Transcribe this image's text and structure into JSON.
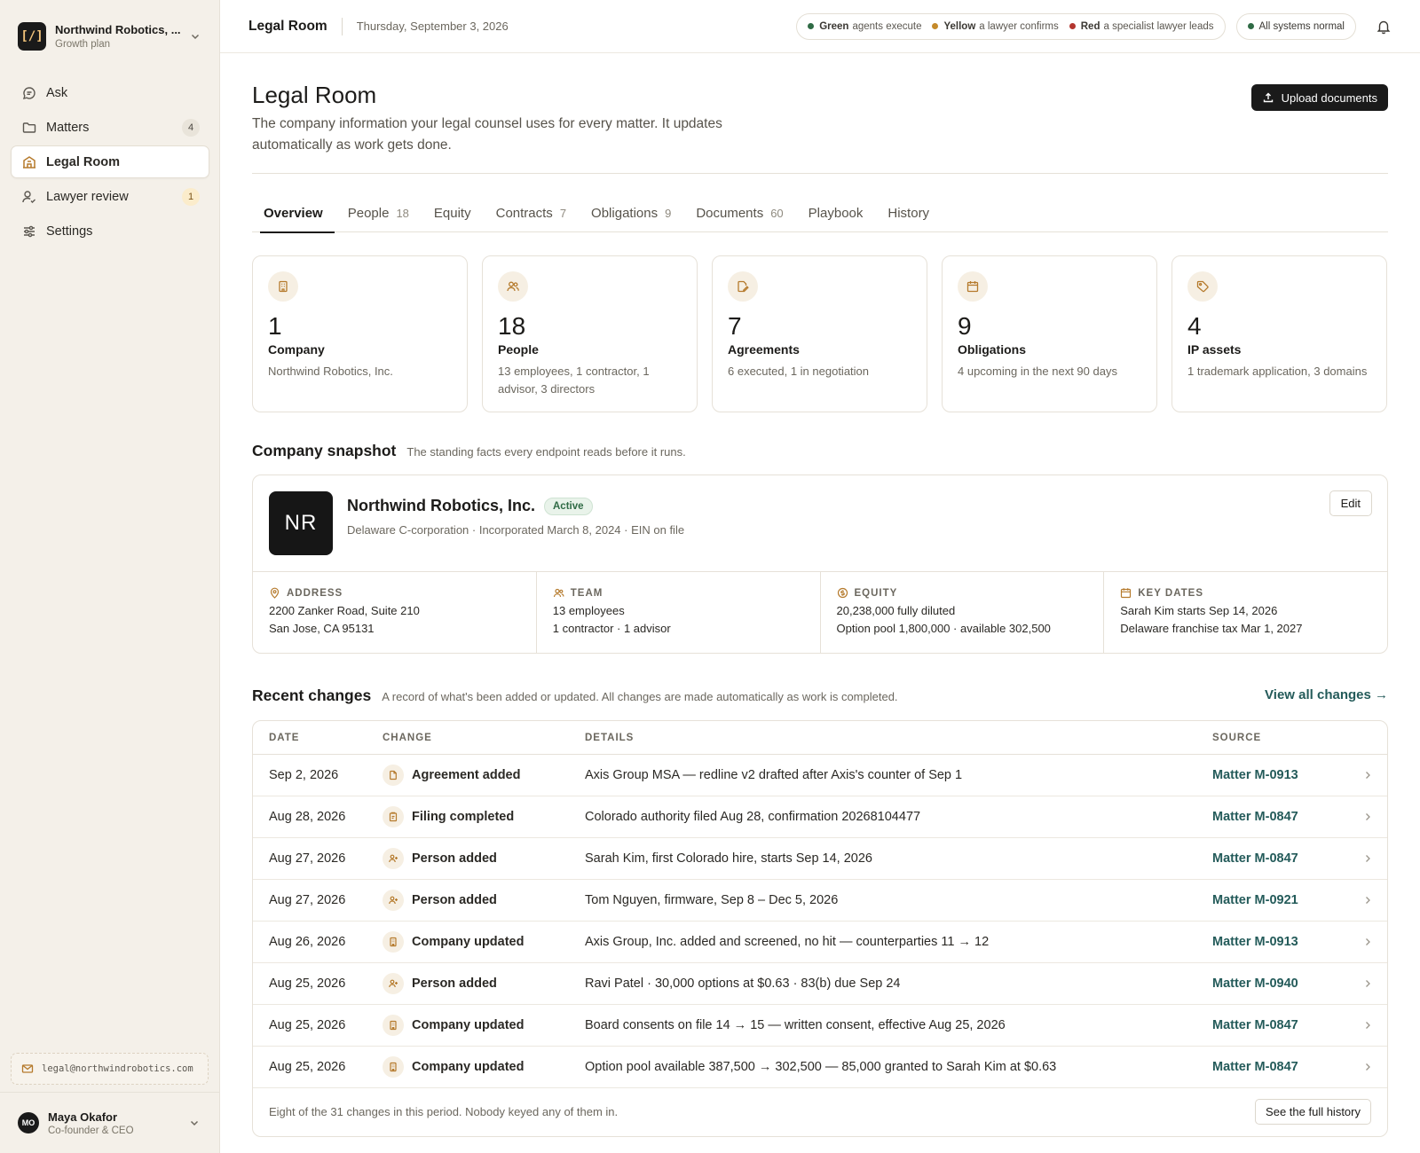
{
  "org": {
    "name": "Northwind Robotics, ...",
    "plan": "Growth plan",
    "logo_text": "[/]"
  },
  "nav": [
    {
      "label": "Ask",
      "icon": "chat-icon",
      "badge": ""
    },
    {
      "label": "Matters",
      "icon": "folder-icon",
      "badge": "4"
    },
    {
      "label": "Legal Room",
      "icon": "building-icon",
      "badge": "",
      "active": true
    },
    {
      "label": "Lawyer review",
      "icon": "user-review-icon",
      "badge": "1"
    },
    {
      "label": "Settings",
      "icon": "sliders-icon",
      "badge": ""
    }
  ],
  "sidebar_email": "legal@northwindrobotics.com",
  "user": {
    "initials": "MO",
    "name": "Maya Okafor",
    "role": "Co-founder & CEO"
  },
  "topbar": {
    "title": "Legal Room",
    "date": "Thursday, September 3, 2026",
    "legend": [
      {
        "strong": "Green",
        "text": "agents execute",
        "color": "#2f6b45"
      },
      {
        "strong": "Yellow",
        "text": "a lawyer confirms",
        "color": "#c58a2a"
      },
      {
        "strong": "Red",
        "text": "a specialist lawyer leads",
        "color": "#b3362f"
      }
    ],
    "status": "All systems normal",
    "status_color": "#2f6b45"
  },
  "page": {
    "title": "Legal Room",
    "subtitle": "The company information your legal counsel uses for every matter. It updates automatically as work gets done.",
    "upload_label": "Upload documents"
  },
  "tabs": [
    {
      "label": "Overview",
      "count": "",
      "active": true
    },
    {
      "label": "People",
      "count": "18"
    },
    {
      "label": "Equity",
      "count": ""
    },
    {
      "label": "Contracts",
      "count": "7"
    },
    {
      "label": "Obligations",
      "count": "9"
    },
    {
      "label": "Documents",
      "count": "60"
    },
    {
      "label": "Playbook",
      "count": ""
    },
    {
      "label": "History",
      "count": ""
    }
  ],
  "stats": [
    {
      "icon": "building-icon",
      "num": "1",
      "label": "Company",
      "desc": "Northwind Robotics, Inc."
    },
    {
      "icon": "people-icon",
      "num": "18",
      "label": "People",
      "desc": "13 employees, 1 contractor, 1 advisor, 3 directors"
    },
    {
      "icon": "edit-doc-icon",
      "num": "7",
      "label": "Agreements",
      "desc": "6 executed, 1 in negotiation"
    },
    {
      "icon": "calendar-icon",
      "num": "9",
      "label": "Obligations",
      "desc": "4 upcoming in the next 90 days"
    },
    {
      "icon": "tag-icon",
      "num": "4",
      "label": "IP assets",
      "desc": "1 trademark application, 3 domains"
    }
  ],
  "snapshot": {
    "title": "Company snapshot",
    "subtitle": "The standing facts every endpoint reads before it runs.",
    "logo": "NR",
    "name": "Northwind Robotics, Inc.",
    "badge": "Active",
    "meta": "Delaware C-corporation · Incorporated March 8, 2024 · EIN on file",
    "edit_label": "Edit",
    "cells": [
      {
        "head": "ADDRESS",
        "icon": "pin-icon",
        "line1": "2200 Zanker Road, Suite 210",
        "line2": "San Jose, CA 95131"
      },
      {
        "head": "TEAM",
        "icon": "people-icon",
        "line1": "13 employees",
        "line2": "1 contractor · 1 advisor"
      },
      {
        "head": "EQUITY",
        "icon": "coin-icon",
        "line1": "20,238,000 fully diluted",
        "line2": "Option pool 1,800,000 · available 302,500"
      },
      {
        "head": "KEY DATES",
        "icon": "calendar-icon",
        "line1": "Sarah Kim starts Sep 14, 2026",
        "line2": "Delaware franchise tax Mar 1, 2027"
      }
    ]
  },
  "changes": {
    "title": "Recent changes",
    "subtitle": "A record of what's been added or updated. All changes are made automatically as work is completed.",
    "view_all": "View all changes →",
    "columns": [
      "DATE",
      "CHANGE",
      "DETAILS",
      "SOURCE"
    ],
    "rows": [
      {
        "date": "Sep 2, 2026",
        "icon": "document-icon",
        "change": "Agreement added",
        "details": "Axis Group MSA — redline v2 drafted after Axis's counter of Sep 1",
        "source": "Matter M-0913"
      },
      {
        "date": "Aug 28, 2026",
        "icon": "clipboard-icon",
        "change": "Filing completed",
        "details": "Colorado authority filed Aug 28, confirmation 20268104477",
        "source": "Matter M-0847"
      },
      {
        "date": "Aug 27, 2026",
        "icon": "person-add-icon",
        "change": "Person added",
        "details": "Sarah Kim, first Colorado hire, starts Sep 14, 2026",
        "source": "Matter M-0847"
      },
      {
        "date": "Aug 27, 2026",
        "icon": "person-add-icon",
        "change": "Person added",
        "details": "Tom Nguyen, firmware, Sep 8 – Dec 5, 2026",
        "source": "Matter M-0921"
      },
      {
        "date": "Aug 26, 2026",
        "icon": "building-icon",
        "change": "Company updated",
        "details": "Axis Group, Inc. added and screened, no hit — counterparties 11 → 12",
        "source": "Matter M-0913"
      },
      {
        "date": "Aug 25, 2026",
        "icon": "person-add-icon",
        "change": "Person added",
        "details": "Ravi Patel · 30,000 options at $0.63 · 83(b) due Sep 24",
        "source": "Matter M-0940"
      },
      {
        "date": "Aug 25, 2026",
        "icon": "building-icon",
        "change": "Company updated",
        "details": "Board consents on file 14 → 15 — written consent, effective Aug 25, 2026",
        "source": "Matter M-0847"
      },
      {
        "date": "Aug 25, 2026",
        "icon": "building-icon",
        "change": "Company updated",
        "details": "Option pool available 387,500 → 302,500 — 85,000 granted to Sarah Kim at $0.63",
        "source": "Matter M-0847"
      }
    ],
    "footer": "Eight of the 31 changes in this period. Nobody keyed any of them in.",
    "history_label": "See the full history"
  }
}
